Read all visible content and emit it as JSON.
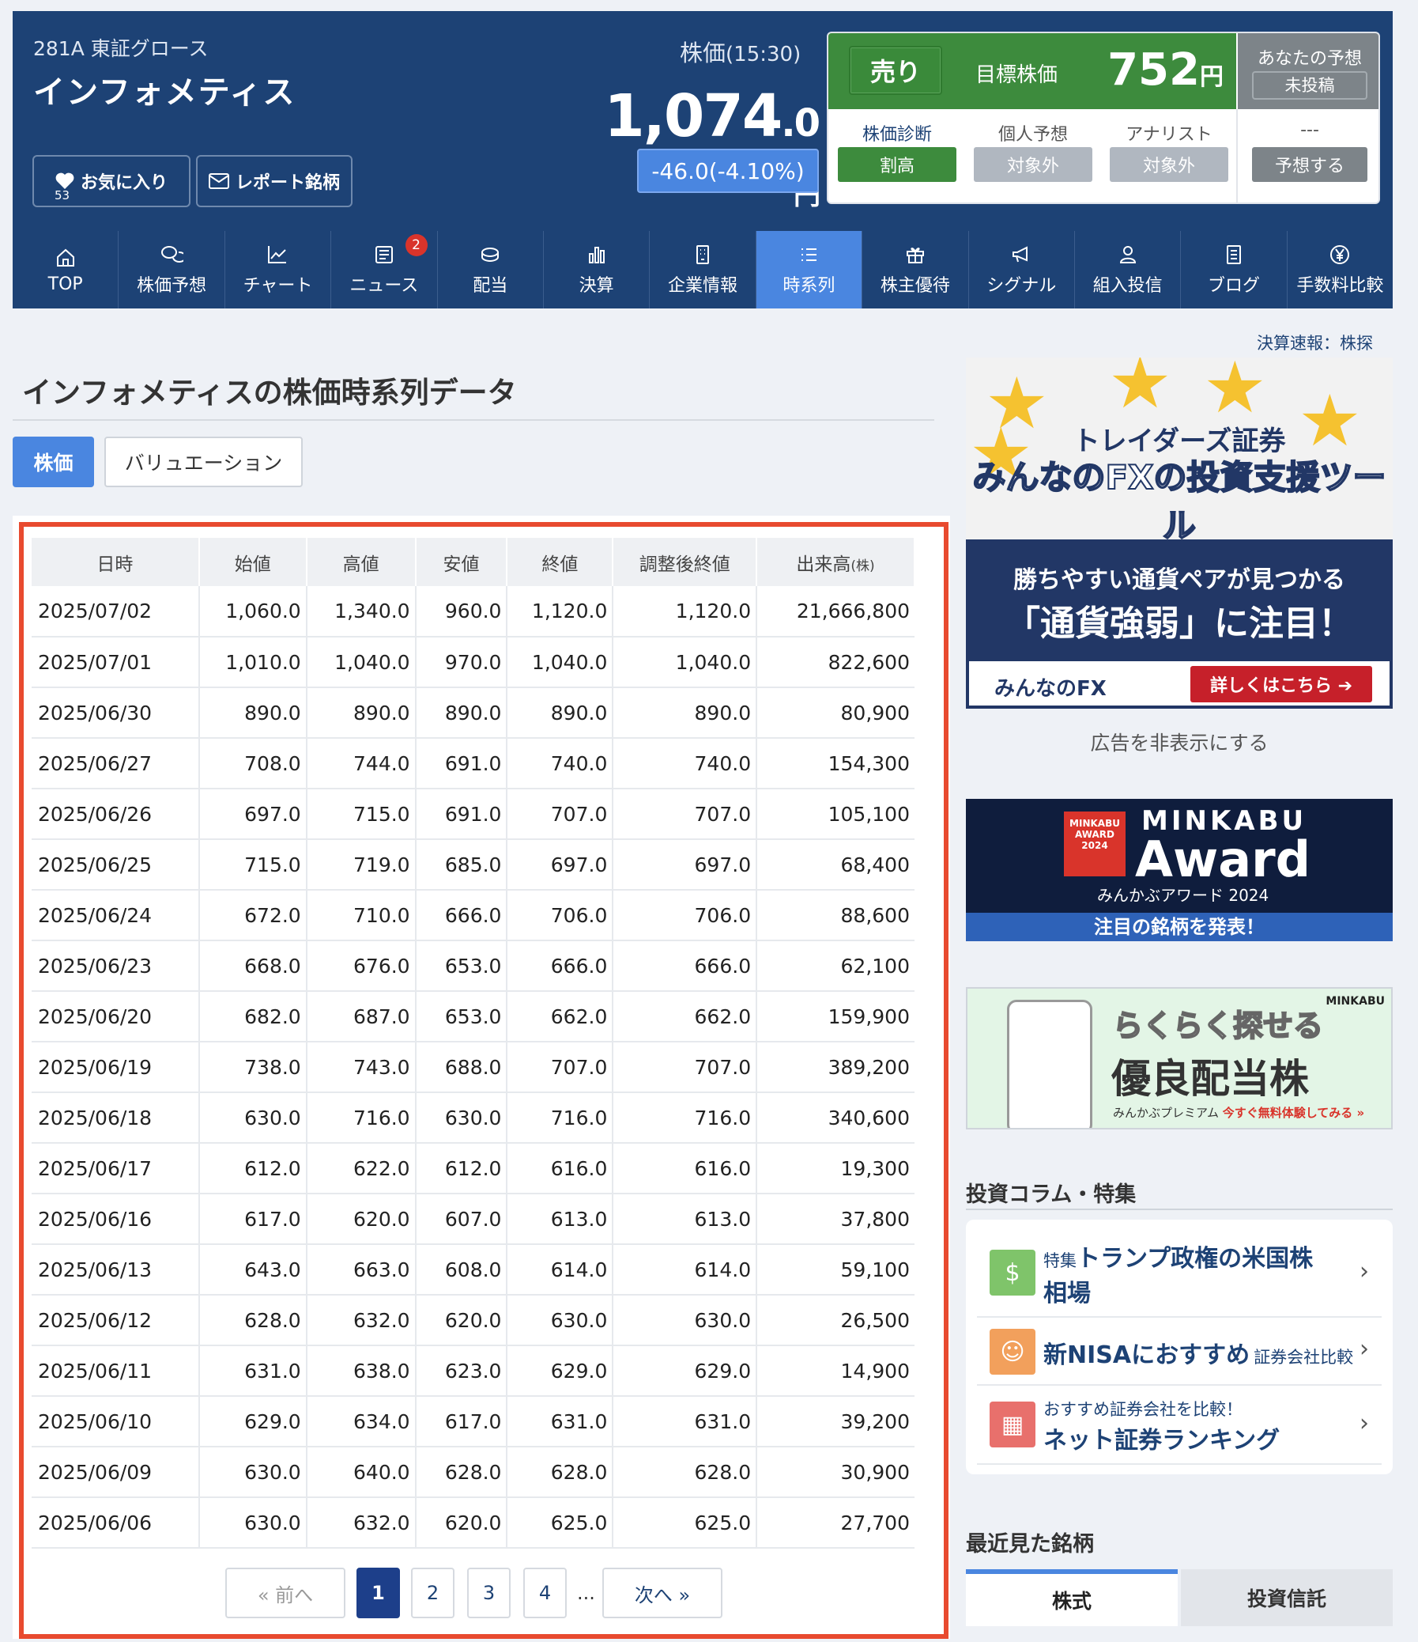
{
  "header": {
    "code_market": "281A 東証グロース",
    "name": "インフォメティス",
    "favorite_label": "お気に入り",
    "favorite_count": "53",
    "report_label": "レポート銘柄",
    "price_label": "株価",
    "price_time": "(15:30)",
    "price_int": "1,074",
    "price_dec": ".0",
    "price_unit": "円",
    "price_change": "-46.0(-4.10%)"
  },
  "rating": {
    "signal": "売り",
    "target_label": "目標株価",
    "target_value": "752",
    "target_unit": "円",
    "yours_label": "あなたの予想",
    "yours_status": "未投稿",
    "diag_label": "株価診断",
    "diag_value": "割高",
    "personal_label": "個人予想",
    "personal_value": "対象外",
    "analyst_label": "アナリスト",
    "analyst_value": "対象外",
    "yours_dash": "---",
    "predict_button": "予想する"
  },
  "nav": {
    "items": [
      {
        "label": "TOP",
        "icon": "home-icon"
      },
      {
        "label": "株価予想",
        "icon": "chat-icon"
      },
      {
        "label": "チャート",
        "icon": "chart-icon"
      },
      {
        "label": "ニュース",
        "icon": "news-icon",
        "badge": "2"
      },
      {
        "label": "配当",
        "icon": "coin-icon"
      },
      {
        "label": "決算",
        "icon": "bar-icon"
      },
      {
        "label": "企業情報",
        "icon": "building-icon"
      },
      {
        "label": "時系列",
        "icon": "list-icon",
        "active": true
      },
      {
        "label": "株主優待",
        "icon": "gift-icon"
      },
      {
        "label": "シグナル",
        "icon": "megaphone-icon"
      },
      {
        "label": "組入投信",
        "icon": "person-icon"
      },
      {
        "label": "ブログ",
        "icon": "document-icon"
      },
      {
        "label": "手数料比較",
        "icon": "yen-icon"
      }
    ]
  },
  "main": {
    "title": "インフォメティスの株価時系列データ",
    "tab_stock": "株価",
    "tab_valuation": "バリュエーション",
    "columns": [
      "日時",
      "始値",
      "高値",
      "安値",
      "終値",
      "調整後終値",
      "出来高"
    ],
    "volume_unit": "(株)",
    "rows": [
      [
        "2025/07/02",
        "1,060.0",
        "1,340.0",
        "960.0",
        "1,120.0",
        "1,120.0",
        "21,666,800"
      ],
      [
        "2025/07/01",
        "1,010.0",
        "1,040.0",
        "970.0",
        "1,040.0",
        "1,040.0",
        "822,600"
      ],
      [
        "2025/06/30",
        "890.0",
        "890.0",
        "890.0",
        "890.0",
        "890.0",
        "80,900"
      ],
      [
        "2025/06/27",
        "708.0",
        "744.0",
        "691.0",
        "740.0",
        "740.0",
        "154,300"
      ],
      [
        "2025/06/26",
        "697.0",
        "715.0",
        "691.0",
        "707.0",
        "707.0",
        "105,100"
      ],
      [
        "2025/06/25",
        "715.0",
        "719.0",
        "685.0",
        "697.0",
        "697.0",
        "68,400"
      ],
      [
        "2025/06/24",
        "672.0",
        "710.0",
        "666.0",
        "706.0",
        "706.0",
        "88,600"
      ],
      [
        "2025/06/23",
        "668.0",
        "676.0",
        "653.0",
        "666.0",
        "666.0",
        "62,100"
      ],
      [
        "2025/06/20",
        "682.0",
        "687.0",
        "653.0",
        "662.0",
        "662.0",
        "159,900"
      ],
      [
        "2025/06/19",
        "738.0",
        "743.0",
        "688.0",
        "707.0",
        "707.0",
        "389,200"
      ],
      [
        "2025/06/18",
        "630.0",
        "716.0",
        "630.0",
        "716.0",
        "716.0",
        "340,600"
      ],
      [
        "2025/06/17",
        "612.0",
        "622.0",
        "612.0",
        "616.0",
        "616.0",
        "19,300"
      ],
      [
        "2025/06/16",
        "617.0",
        "620.0",
        "607.0",
        "613.0",
        "613.0",
        "37,800"
      ],
      [
        "2025/06/13",
        "643.0",
        "663.0",
        "608.0",
        "614.0",
        "614.0",
        "59,100"
      ],
      [
        "2025/06/12",
        "628.0",
        "632.0",
        "620.0",
        "630.0",
        "630.0",
        "26,500"
      ],
      [
        "2025/06/11",
        "631.0",
        "638.0",
        "623.0",
        "629.0",
        "629.0",
        "14,900"
      ],
      [
        "2025/06/10",
        "629.0",
        "634.0",
        "617.0",
        "631.0",
        "631.0",
        "39,200"
      ],
      [
        "2025/06/09",
        "630.0",
        "640.0",
        "628.0",
        "628.0",
        "628.0",
        "30,900"
      ],
      [
        "2025/06/06",
        "630.0",
        "632.0",
        "620.0",
        "625.0",
        "625.0",
        "27,700"
      ]
    ],
    "pager": {
      "prev": "« 前へ",
      "pages": [
        "1",
        "2",
        "3",
        "4"
      ],
      "ellipsis": "...",
      "next": "次へ »",
      "current": "1"
    }
  },
  "sidebar": {
    "top_link": "決算速報：株探",
    "ad1": {
      "line1": "トレイダーズ証券",
      "line2": "みんなのFXの投資支援ツール",
      "line3": "勝ちやすい通貨ペアが見つかる",
      "line4": "「通貨強弱」に注目！",
      "brand": "みんなのFX",
      "cta": "詳しくはこちら ➔"
    },
    "hide_ad": "広告を非表示にする",
    "ad2": {
      "logo": "MINKABU AWARD 2024",
      "line1": "MINKABU",
      "line2": "Award",
      "line3": "みんかぶアワード 2024",
      "bar": "注目の銘柄を発表！"
    },
    "ad3": {
      "brand": "MINKABU",
      "line1": "らくらく探せる",
      "line2": "優良配当株",
      "line3": "みんかぶプレミアム",
      "cta": "今すぐ無料体験してみる »"
    },
    "column_title": "投資コラム・特集",
    "columns": [
      {
        "small": "特集",
        "big": "トランプ政権の米国株相場"
      },
      {
        "big": "新NISAにおすすめ",
        "small": "証券会社比較"
      },
      {
        "small": "おすすめ証券会社を比較！",
        "big": "ネット証券ランキング"
      }
    ],
    "recent_title": "最近見た銘柄",
    "recent_tabs": [
      "株式",
      "投資信託"
    ]
  },
  "colors": {
    "header_bg": "#1d4275",
    "accent": "#4a86e0",
    "sell_green": "#3d8b3d",
    "highlight_frame": "#e84a2f"
  }
}
